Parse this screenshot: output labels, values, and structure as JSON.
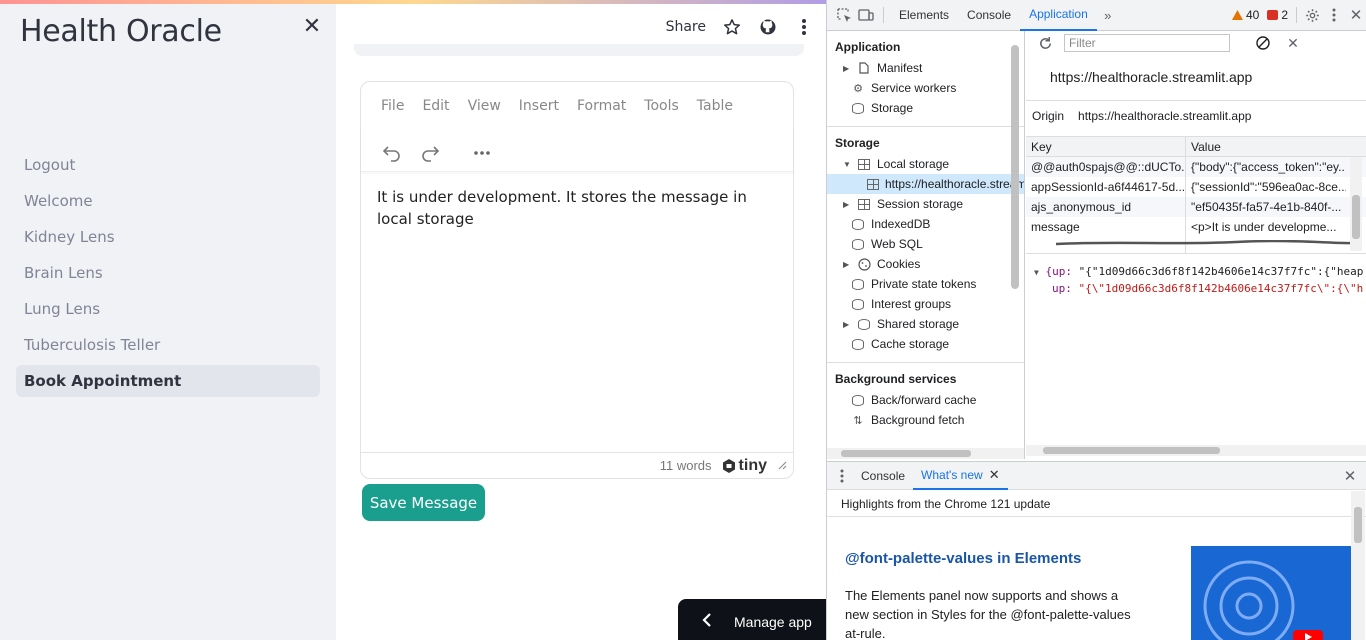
{
  "sidebar": {
    "app_title": "Health Oracle",
    "close_glyph": "✕",
    "nav": [
      {
        "label": "Logout"
      },
      {
        "label": "Welcome"
      },
      {
        "label": "Kidney Lens"
      },
      {
        "label": "Brain Lens"
      },
      {
        "label": "Lung Lens"
      },
      {
        "label": "Tuberculosis Teller"
      },
      {
        "label": "Book Appointment",
        "active": true
      }
    ]
  },
  "header": {
    "share_label": "Share",
    "icons": [
      "star-icon",
      "github-icon",
      "more-vertical-icon"
    ]
  },
  "editor": {
    "menus": [
      "File",
      "Edit",
      "View",
      "Insert",
      "Format",
      "Tools",
      "Table"
    ],
    "toolbar_icons": [
      "undo-icon",
      "redo-icon",
      "more-horizontal-icon"
    ],
    "content": "It is under development. It stores the message in local storage",
    "word_count": "11 words",
    "brand": "tiny"
  },
  "save_button": "Save Message",
  "manage_app": "Manage app",
  "devtools": {
    "tabs": [
      "Elements",
      "Console",
      "Application"
    ],
    "active_tab": "Application",
    "warnings": "40",
    "errors": "2",
    "application_title": "Application",
    "app_items": [
      "Manifest",
      "Service workers",
      "Storage"
    ],
    "storage_title": "Storage",
    "storage_items": {
      "local_storage": "Local storage",
      "local_origin": "https://healthoracle.streamlit.app",
      "session_storage": "Session storage",
      "indexeddb": "IndexedDB",
      "websql": "Web SQL",
      "cookies": "Cookies",
      "private_state": "Private state tokens",
      "interest_groups": "Interest groups",
      "shared_storage": "Shared storage",
      "cache_storage": "Cache storage"
    },
    "background_title": "Background services",
    "background_items": [
      "Back/forward cache",
      "Background fetch"
    ],
    "filter_placeholder": "Filter",
    "origin_url": "https://healthoracle.streamlit.app",
    "origin_label": "Origin",
    "origin_value": "https://healthoracle.streamlit.app",
    "table_headers": {
      "key": "Key",
      "value": "Value"
    },
    "rows": [
      {
        "key": "@@auth0spajs@@::dUCTo...",
        "value": "{\"body\":{\"access_token\":\"ey..."
      },
      {
        "key": "appSessionId-a6f44617-5d...",
        "value": "{\"sessionId\":\"596ea0ac-8ce..."
      },
      {
        "key": "ajs_anonymous_id",
        "value": "\"ef50435f-fa57-4e1b-840f-..."
      },
      {
        "key": "message",
        "value": "<p>It is under developme..."
      }
    ],
    "json_line1_key": "{up:",
    "json_line1_val": "\"{\"1d09d66c3d6f8f142b4606e14c37f7fc\":{\"heap",
    "json_line2_key": "up:",
    "json_line2_val": "\"{\\\"1d09d66c3d6f8f142b4606e14c37f7fc\\\":{\\\"h",
    "drawer_tabs": [
      "Console",
      "What's new"
    ],
    "drawer_active": "What's new",
    "whatsnew_sub": "Highlights from the Chrome 121 update",
    "feature_title": "@font-palette-values in Elements",
    "feature_desc": "The Elements panel now supports and shows a new section in Styles for the @font-palette-values at-rule."
  }
}
